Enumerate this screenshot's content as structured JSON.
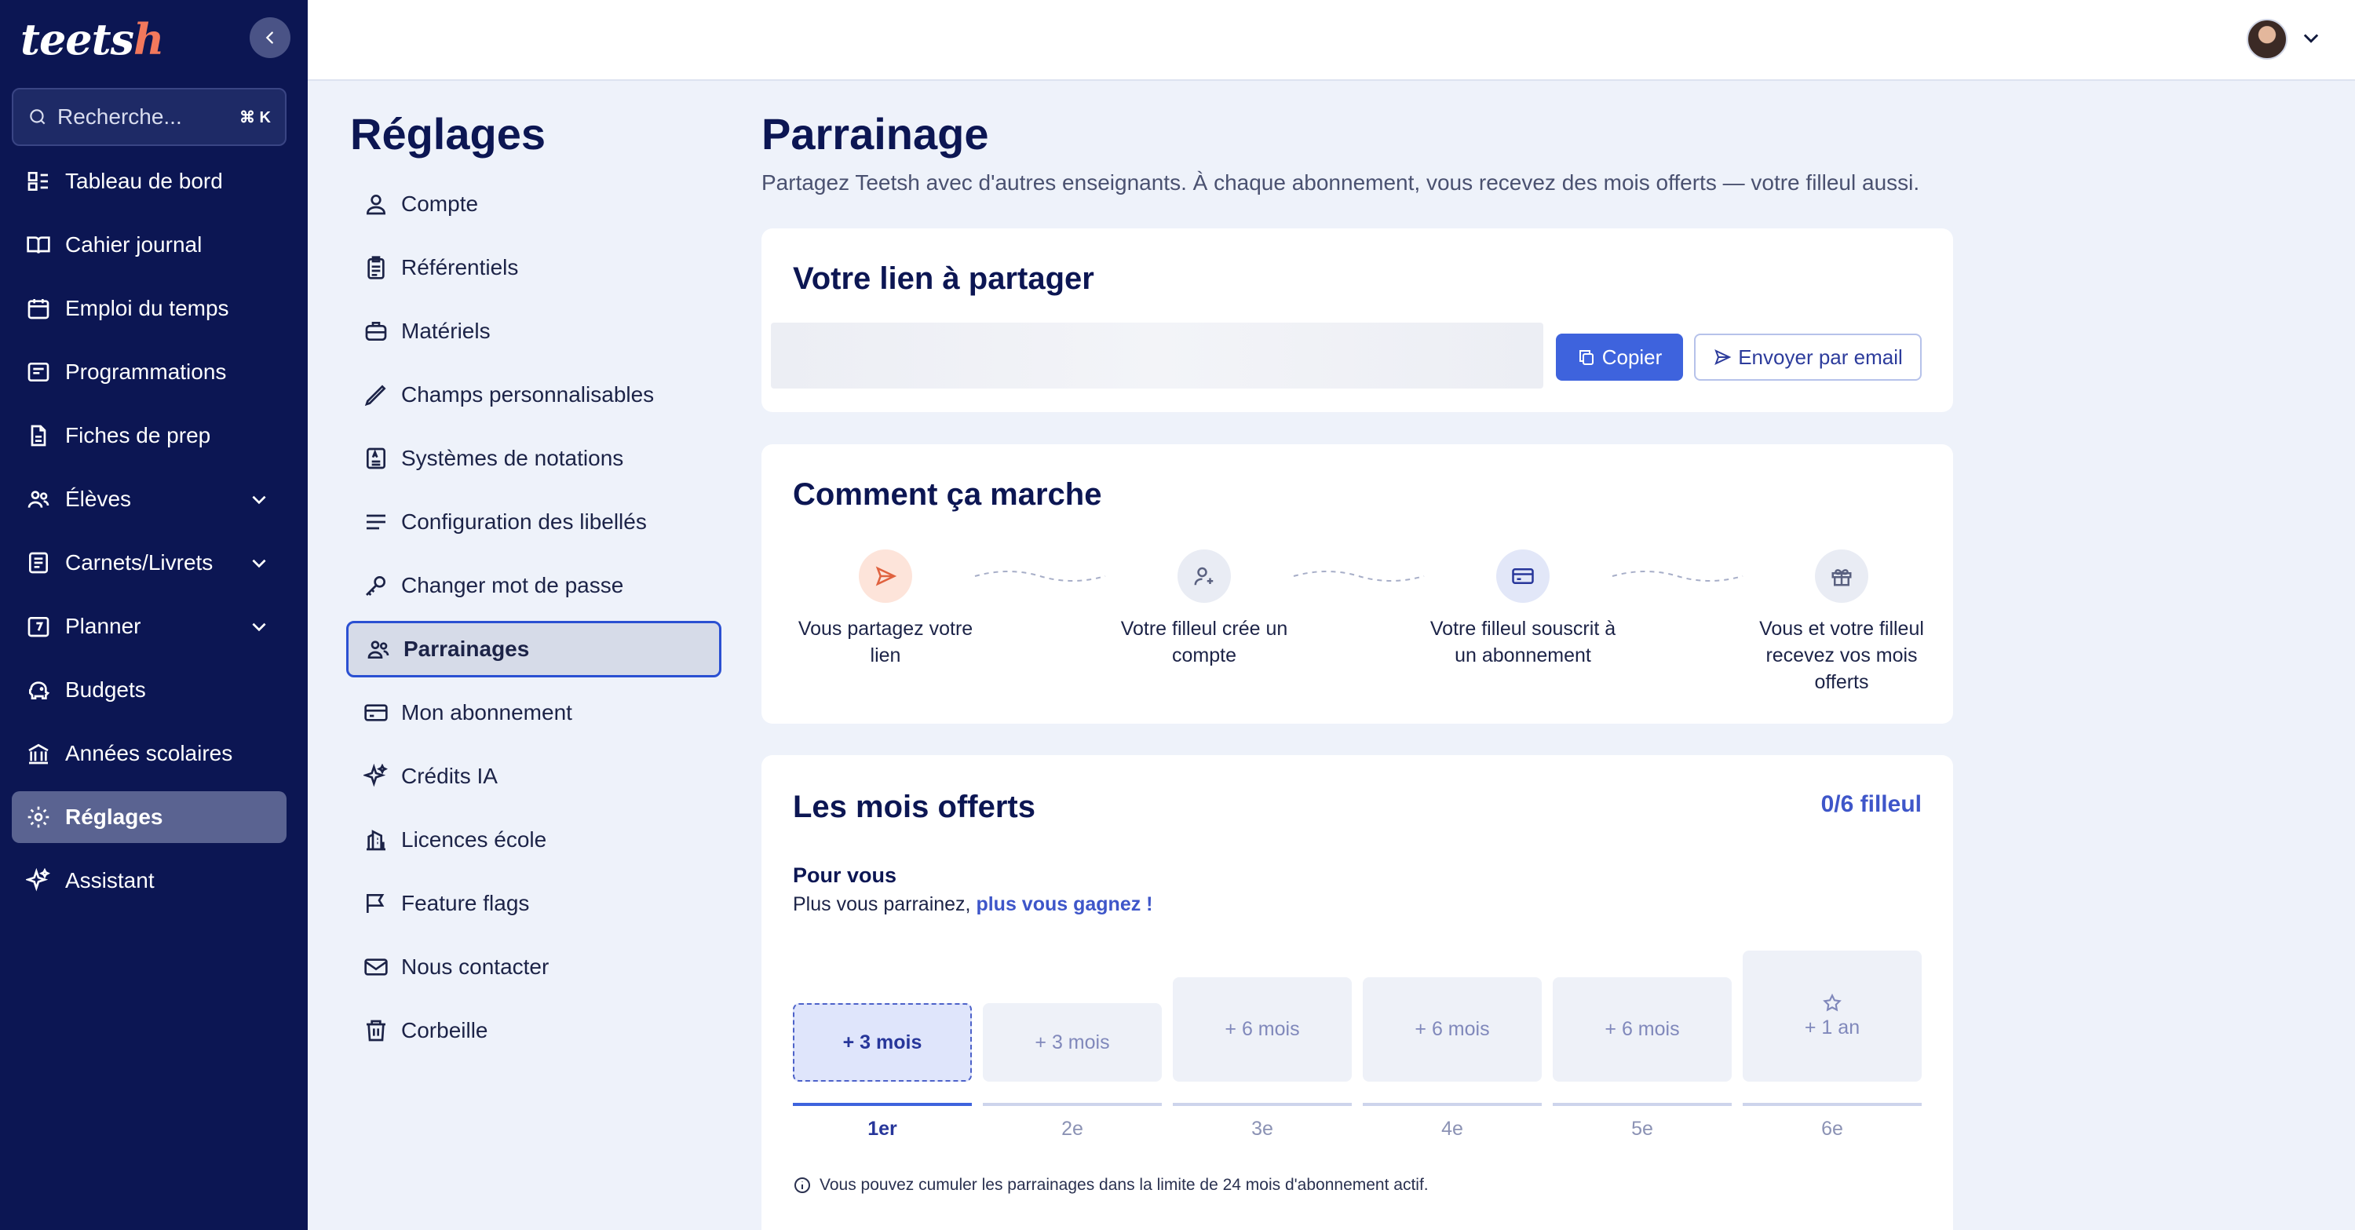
{
  "app": {
    "logo_text": "teets",
    "logo_accent": "h"
  },
  "search": {
    "placeholder": "Recherche...",
    "shortcut": "⌘ K"
  },
  "nav": {
    "items": [
      {
        "label": "Tableau de bord",
        "icon": "dashboard-icon"
      },
      {
        "label": "Cahier journal",
        "icon": "book-icon"
      },
      {
        "label": "Emploi du temps",
        "icon": "calendar-icon"
      },
      {
        "label": "Programmations",
        "icon": "schedule-icon"
      },
      {
        "label": "Fiches de prep",
        "icon": "file-icon"
      },
      {
        "label": "Élèves",
        "icon": "users-icon",
        "expandable": true
      },
      {
        "label": "Carnets/Livrets",
        "icon": "notebook-icon",
        "expandable": true
      },
      {
        "label": "Planner",
        "icon": "planner-icon",
        "expandable": true
      },
      {
        "label": "Budgets",
        "icon": "piggy-bank-icon"
      },
      {
        "label": "Années scolaires",
        "icon": "school-icon"
      },
      {
        "label": "Réglages",
        "icon": "gear-icon",
        "active": true
      },
      {
        "label": "Assistant",
        "icon": "sparkles-icon"
      }
    ]
  },
  "settings": {
    "title": "Réglages",
    "items": [
      {
        "label": "Compte",
        "icon": "user-icon"
      },
      {
        "label": "Référentiels",
        "icon": "clipboard-icon"
      },
      {
        "label": "Matériels",
        "icon": "briefcase-icon"
      },
      {
        "label": "Champs personnalisables",
        "icon": "pencil-icon"
      },
      {
        "label": "Systèmes de notations",
        "icon": "grading-icon"
      },
      {
        "label": "Configuration des libellés",
        "icon": "lines-icon"
      },
      {
        "label": "Changer mot de passe",
        "icon": "key-icon"
      },
      {
        "label": "Parrainages",
        "icon": "users-icon",
        "active": true
      },
      {
        "label": "Mon abonnement",
        "icon": "credit-card-icon"
      },
      {
        "label": "Crédits IA",
        "icon": "sparkles-icon"
      },
      {
        "label": "Licences école",
        "icon": "building-icon"
      },
      {
        "label": "Feature flags",
        "icon": "flag-icon"
      },
      {
        "label": "Nous contacter",
        "icon": "mail-icon"
      },
      {
        "label": "Corbeille",
        "icon": "trash-icon"
      }
    ]
  },
  "page": {
    "title": "Parrainage",
    "subtitle": "Partagez Teetsh avec d'autres enseignants. À chaque abonnement, vous recevez des mois offerts — votre filleul aussi."
  },
  "share": {
    "title": "Votre lien à partager",
    "copy_label": "Copier",
    "email_label": "Envoyer par email"
  },
  "how": {
    "title": "Comment ça marche",
    "steps": [
      {
        "label": "Vous partagez votre lien",
        "icon": "send-icon"
      },
      {
        "label": "Votre filleul crée un compte",
        "icon": "user-plus-icon"
      },
      {
        "label": "Votre filleul souscrit à un abonnement",
        "icon": "credit-card-icon"
      },
      {
        "label": "Vous et votre filleul recevez vos mois offerts",
        "icon": "gift-icon"
      }
    ]
  },
  "rewards": {
    "title": "Les mois offerts",
    "counter": "0/6 filleul",
    "for_you": "Pour vous",
    "sub_prefix": "Plus vous parrainez,",
    "sub_highlight": "plus vous gagnez !",
    "tiers": [
      {
        "label": "+ 3 mois",
        "rank": "1er",
        "active": true
      },
      {
        "label": "+ 3 mois",
        "rank": "2e"
      },
      {
        "label": "+ 6 mois",
        "rank": "3e"
      },
      {
        "label": "+ 6 mois",
        "rank": "4e"
      },
      {
        "label": "+ 6 mois",
        "rank": "5e"
      },
      {
        "label": "+ 1 an",
        "rank": "6e",
        "star": true
      }
    ],
    "note": "Vous pouvez cumuler les parrainages dans la limite de 24 mois d'abonnement actif."
  },
  "colors": {
    "sidebar": "#0c1653",
    "accent": "#3e63dd",
    "active_border": "#2b50d2"
  }
}
